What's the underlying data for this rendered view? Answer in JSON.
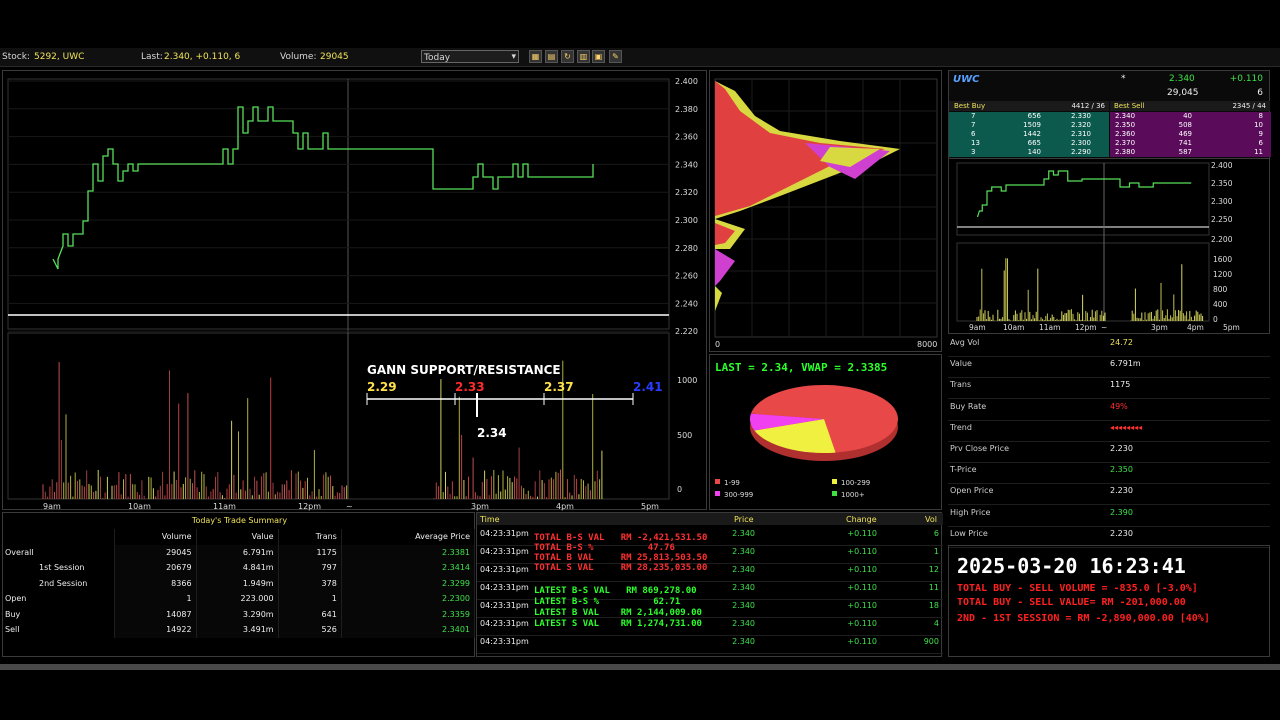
{
  "topbar": {
    "stock_label": "Stock:",
    "stock_value": "5292,  UWC",
    "last_label": "Last:",
    "last_value": "2.340, +0.110, 6",
    "volume_label": "Volume:",
    "volume_value": "29045",
    "period_select": "Today"
  },
  "main_chart": {
    "y_ticks": [
      "2.400",
      "2.380",
      "2.360",
      "2.340",
      "2.320",
      "2.300",
      "2.280",
      "2.260",
      "2.240",
      "2.220"
    ],
    "vol_ticks": [
      "1000",
      "500",
      "0"
    ],
    "x_ticks": [
      "9am",
      "10am",
      "11am",
      "12pm",
      "~",
      "3pm",
      "4pm",
      "5pm"
    ],
    "gann_title": "GANN SUPPORT/RESISTANCE",
    "gann_levels": [
      "2.29",
      "2.33",
      "2.37",
      "2.41"
    ],
    "gann_current": "2.34",
    "colors": {
      "price_line": "#58e05a",
      "white_line": "#ffffff",
      "gann_yellow": "#ffe14a",
      "gann_red": "#ff2a2a",
      "gann_blue": "#2a3cff"
    }
  },
  "profile_chart": {
    "x_ticks": [
      "0",
      "8000"
    ],
    "colors": {
      "red": "#e04040",
      "yellow": "#d8d840",
      "magenta": "#d040d0"
    }
  },
  "pie": {
    "title": "LAST = 2.34, VWAP = 2.3385",
    "legend": [
      "1-99",
      "100-299",
      "300-999",
      "1000+"
    ],
    "colors": [
      "#e84848",
      "#f0f040",
      "#f040f0",
      "#40e040"
    ],
    "values": [
      70,
      22,
      8,
      0
    ]
  },
  "quote": {
    "symbol": "UWC",
    "star": "*",
    "last": "2.340",
    "change": "+0.110",
    "volume": "29,045",
    "trades": "6",
    "best_buy_label": "Best Buy",
    "best_buy_size": "4412 / 36",
    "best_sell_label": "Best Sell",
    "best_sell_size": "2345 / 44",
    "depth": [
      [
        "7",
        "656",
        "2.330",
        "2.340",
        "40",
        "8"
      ],
      [
        "7",
        "1509",
        "2.320",
        "2.350",
        "508",
        "10"
      ],
      [
        "6",
        "1442",
        "2.310",
        "2.360",
        "469",
        "9"
      ],
      [
        "13",
        "665",
        "2.300",
        "2.370",
        "741",
        "6"
      ],
      [
        "3",
        "140",
        "2.290",
        "2.380",
        "587",
        "11"
      ]
    ]
  },
  "mini_chart": {
    "y_ticks": [
      "2.400",
      "2.350",
      "2.300",
      "2.250",
      "2.200"
    ],
    "vol_ticks": [
      "1600",
      "1200",
      "800",
      "400",
      "0"
    ],
    "x_ticks": [
      "9am",
      "10am",
      "11am",
      "12pm",
      "~",
      "3pm",
      "4pm",
      "5pm"
    ]
  },
  "stats": [
    {
      "label": "Avg Vol",
      "value": "24.72",
      "color": "#f0e35a"
    },
    {
      "label": "Value",
      "value": "6.791m",
      "color": "#eeeeee"
    },
    {
      "label": "Trans",
      "value": "1175",
      "color": "#eeeeee"
    },
    {
      "label": "Buy Rate",
      "value": "49%",
      "color": "#ff3030"
    },
    {
      "label": "Trend",
      "value": "◂◂◂◂◂◂◂◂",
      "color": "#ff3030"
    },
    {
      "label": "Prv Close Price",
      "value": "2.230",
      "color": "#eeeeee"
    },
    {
      "label": "T-Price",
      "value": "2.350",
      "color": "#3fe04a"
    },
    {
      "label": "Open Price",
      "value": "2.230",
      "color": "#eeeeee"
    },
    {
      "label": "High Price",
      "value": "2.390",
      "color": "#3fe04a"
    },
    {
      "label": "Low Price",
      "value": "2.230",
      "color": "#eeeeee"
    }
  ],
  "summary": {
    "title": "Today's Trade Summary",
    "headers": [
      "",
      "Volume",
      "Value",
      "Trans",
      "Average Price"
    ],
    "rows": [
      [
        "Overall",
        "29045",
        "6.791m",
        "1175",
        "2.3381"
      ],
      [
        "1st Session",
        "20679",
        "4.841m",
        "797",
        "2.3414"
      ],
      [
        "2nd Session",
        "8366",
        "1.949m",
        "378",
        "2.3299"
      ],
      [
        "Open",
        "1",
        "223.000",
        "1",
        "2.2300"
      ],
      [
        "Buy",
        "14087",
        "3.290m",
        "641",
        "2.3359"
      ],
      [
        "Sell",
        "14922",
        "3.491m",
        "526",
        "2.3401"
      ]
    ]
  },
  "trades": {
    "headers": [
      "Time",
      "Price",
      "Change",
      "Vol"
    ],
    "rows": [
      [
        "04:23:31pm",
        "2.340",
        "+0.110",
        "6"
      ],
      [
        "04:23:31pm",
        "2.340",
        "+0.110",
        "1"
      ],
      [
        "04:23:31pm",
        "2.340",
        "+0.110",
        "12"
      ],
      [
        "04:23:31pm",
        "2.340",
        "+0.110",
        "11"
      ],
      [
        "04:23:31pm",
        "2.340",
        "+0.110",
        "18"
      ],
      [
        "04:23:31pm",
        "2.340",
        "+0.110",
        "4"
      ],
      [
        "04:23:31pm",
        "2.340",
        "+0.110",
        "900"
      ]
    ],
    "overlay_red": [
      "TOTAL B-S VAL   RM -2,421,531.50",
      "TOTAL B-S %          47.76",
      "TOTAL B VAL     RM 25,813,503.50",
      "TOTAL S VAL     RM 28,235,035.00"
    ],
    "overlay_green": [
      "LATEST B-S VAL   RM 869,278.00",
      "LATEST B-S %          62.71",
      "LATEST B VAL    RM 2,144,009.00",
      "LATEST S VAL    RM 1,274,731.00"
    ]
  },
  "info": {
    "datetime": "2025-03-20 16:23:41",
    "line1": "TOTAL BUY - SELL VOLUME = -835.0 [-3.0%]",
    "line2": "TOTAL BUY - SELL VALUE= RM -201,000.00",
    "line3": "2ND - 1ST SESSION = RM -2,890,000.00 [40%]"
  }
}
